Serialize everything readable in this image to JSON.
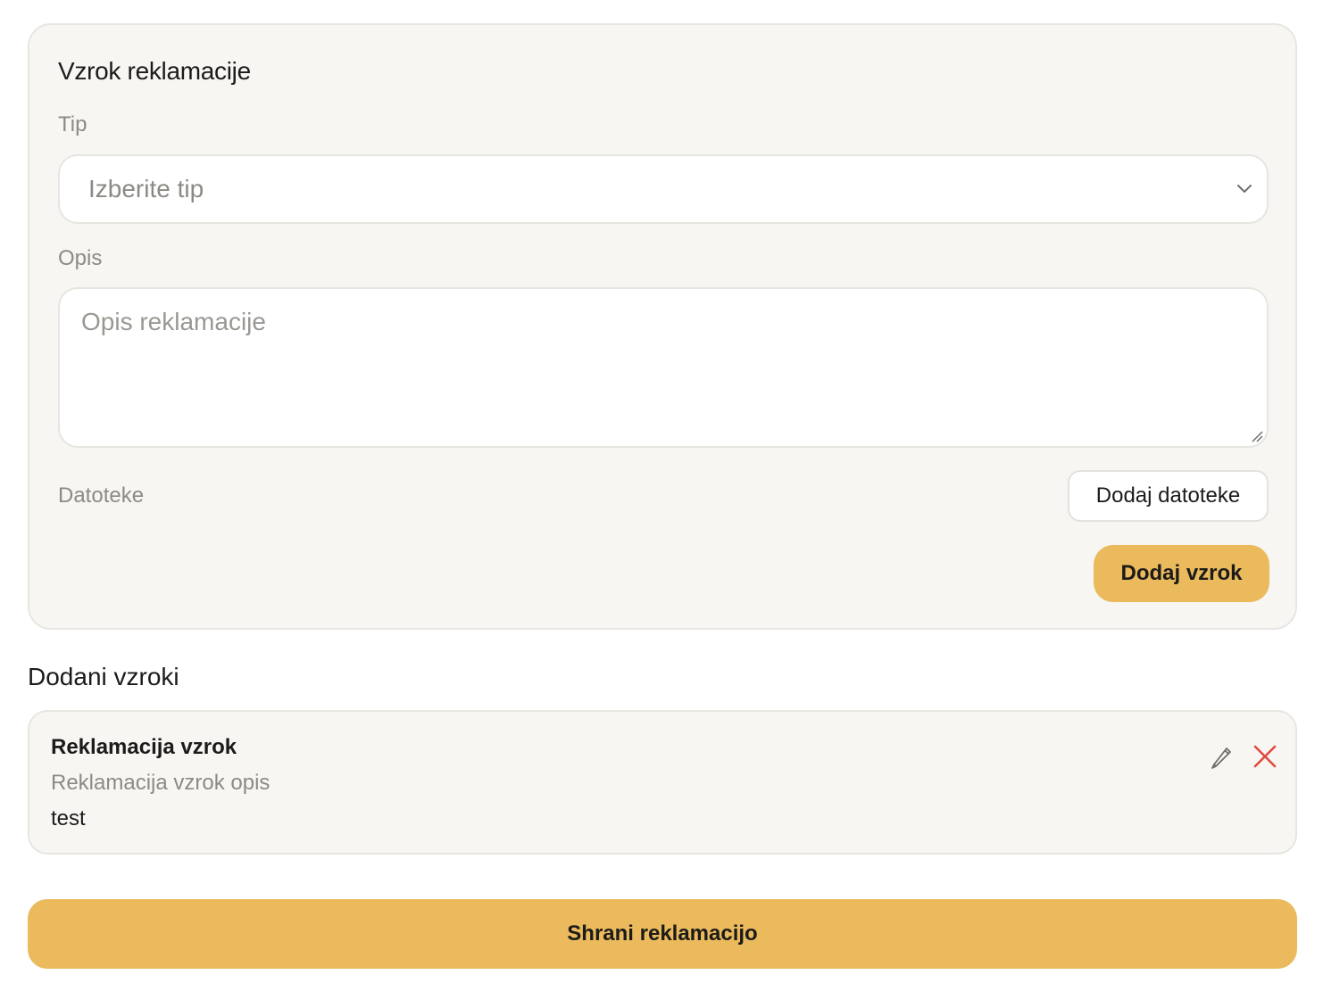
{
  "form": {
    "title": "Vzrok reklamacije",
    "type_label": "Tip",
    "type_placeholder": "Izberite tip",
    "description_label": "Opis",
    "description_placeholder": "Opis reklamacije",
    "files_label": "Datoteke",
    "add_files_label": "Dodaj datoteke",
    "add_cause_label": "Dodaj vzrok"
  },
  "added": {
    "title": "Dodani vzroki",
    "items": [
      {
        "title": "Reklamacija vzrok",
        "description_label": "Reklamacija vzrok opis",
        "description": "test",
        "edit_icon": "pencil-icon",
        "delete_icon": "close-icon"
      }
    ]
  },
  "save_label": "Shrani reklamacijo",
  "colors": {
    "accent": "#eaba5c",
    "card_bg": "#f7f6f3",
    "border": "#e8e6e1",
    "muted_text": "#8c8a85",
    "delete": "#e04a3f"
  }
}
